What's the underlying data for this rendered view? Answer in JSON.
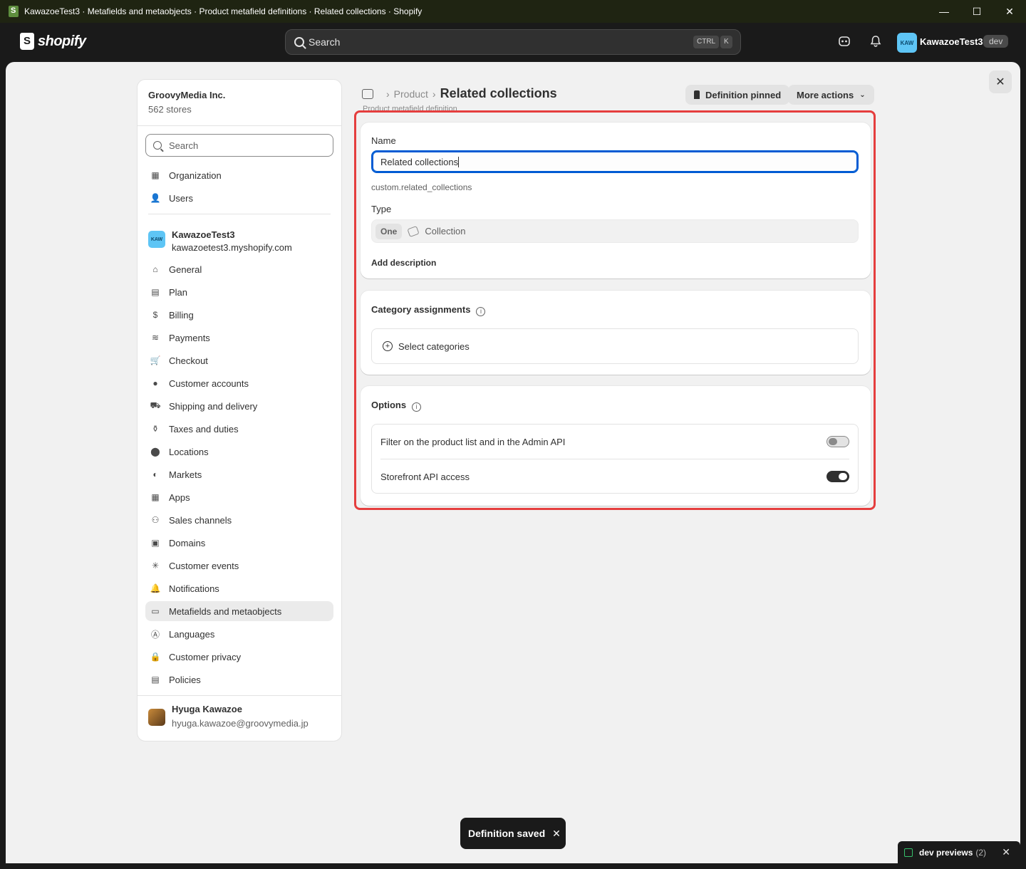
{
  "window": {
    "title": "KawazoeTest3 · Metafields and metaobjects · Product metafield definitions · Related collections · Shopify",
    "minimize": "—",
    "maximize": "☐",
    "close": "✕"
  },
  "topbar": {
    "logo_text": "shopify",
    "search_placeholder": "Search",
    "shortcut_ctrl": "CTRL",
    "shortcut_k": "K",
    "store_avatar": "KAW",
    "store_name": "KawazoeTest3",
    "badge": "dev"
  },
  "sidebar": {
    "org_name": "GroovyMedia Inc.",
    "org_stores": "562 stores",
    "search_placeholder": "Search",
    "org_items": [
      {
        "label": "Organization",
        "icon": "building-icon"
      },
      {
        "label": "Users",
        "icon": "users-icon"
      }
    ],
    "store": {
      "avatar": "KAW",
      "name": "KawazoeTest3",
      "domain": "kawazoetest3.myshopify.com"
    },
    "items": [
      {
        "label": "General",
        "icon": "store-icon"
      },
      {
        "label": "Plan",
        "icon": "plan-icon"
      },
      {
        "label": "Billing",
        "icon": "billing-icon"
      },
      {
        "label": "Payments",
        "icon": "payments-icon"
      },
      {
        "label": "Checkout",
        "icon": "cart-icon"
      },
      {
        "label": "Customer accounts",
        "icon": "person-icon"
      },
      {
        "label": "Shipping and delivery",
        "icon": "truck-icon"
      },
      {
        "label": "Taxes and duties",
        "icon": "tax-icon"
      },
      {
        "label": "Locations",
        "icon": "location-icon"
      },
      {
        "label": "Markets",
        "icon": "globe-icon"
      },
      {
        "label": "Apps",
        "icon": "apps-icon"
      },
      {
        "label": "Sales channels",
        "icon": "channels-icon"
      },
      {
        "label": "Domains",
        "icon": "domains-icon"
      },
      {
        "label": "Customer events",
        "icon": "cursor-icon"
      },
      {
        "label": "Notifications",
        "icon": "bell-icon"
      },
      {
        "label": "Metafields and metaobjects",
        "icon": "metafields-icon",
        "active": true
      },
      {
        "label": "Languages",
        "icon": "language-icon"
      },
      {
        "label": "Customer privacy",
        "icon": "lock-icon"
      },
      {
        "label": "Policies",
        "icon": "policies-icon"
      }
    ],
    "user": {
      "name": "Hyuga Kawazoe",
      "email": "hyuga.kawazoe@groovymedia.jp"
    }
  },
  "header": {
    "breadcrumb_parent": "Product",
    "title": "Related collections",
    "subtitle": "Product metafield definition",
    "pinned_label": "Definition pinned",
    "more_actions_label": "More actions"
  },
  "definition_card": {
    "name_label": "Name",
    "name_value": "Related collections",
    "namespace_key": "custom.related_collections",
    "type_label": "Type",
    "type_cardinality": "One",
    "type_value": "Collection",
    "add_description": "Add description"
  },
  "category_card": {
    "title": "Category assignments",
    "select_label": "Select categories"
  },
  "options_card": {
    "title": "Options",
    "rows": [
      {
        "label": "Filter on the product list and in the Admin API",
        "enabled": false
      },
      {
        "label": "Storefront API access",
        "enabled": true
      }
    ]
  },
  "toast": {
    "message": "Definition saved"
  },
  "dev_previews": {
    "label": "dev previews",
    "count": "(2)"
  },
  "colors": {
    "accent_focus": "#005bd3",
    "highlight": "#e53e3e",
    "topbar": "#1a1a1a"
  }
}
